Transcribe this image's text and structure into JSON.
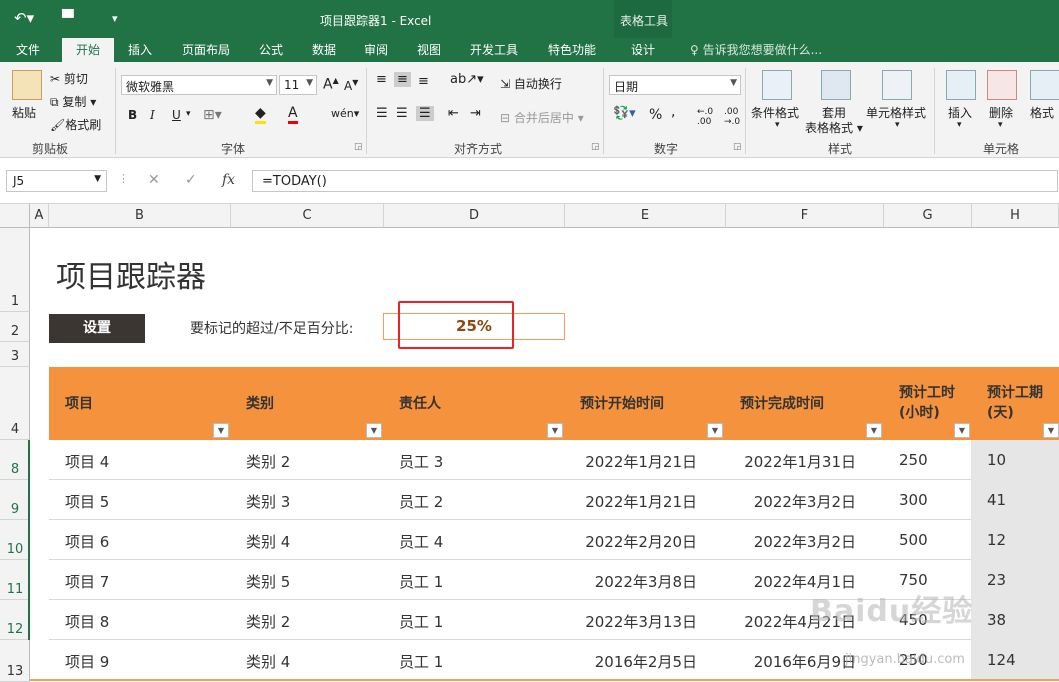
{
  "window": {
    "title": "项目跟踪器1 - Excel",
    "context_group": "表格工具"
  },
  "ribbon_tabs": [
    "文件",
    "开始",
    "插入",
    "页面布局",
    "公式",
    "数据",
    "审阅",
    "视图",
    "开发工具",
    "特色功能",
    "设计"
  ],
  "tell_me": "告诉我您想要做什么...",
  "clipboard": {
    "paste": "粘贴",
    "cut": "剪切",
    "copy": "复制",
    "format_painter": "格式刷",
    "label": "剪贴板"
  },
  "font": {
    "name": "微软雅黑",
    "size": "11",
    "label": "字体",
    "bold": "B",
    "italic": "I",
    "underline": "U"
  },
  "alignment": {
    "wrap": "自动换行",
    "merge": "合并后居中",
    "label": "对齐方式"
  },
  "number": {
    "format": "日期",
    "label": "数字"
  },
  "styles": {
    "conditional": "条件格式",
    "table_fmt_1": "套用",
    "table_fmt_2": "表格格式",
    "cell_styles": "单元格样式",
    "label": "样式"
  },
  "cells": {
    "insert": "插入",
    "delete": "删除",
    "format": "格式",
    "label": "单元格"
  },
  "formula_bar": {
    "name_box": "J5",
    "formula": "=TODAY()",
    "fx": "fx"
  },
  "columns": [
    "A",
    "B",
    "C",
    "D",
    "E",
    "F",
    "G",
    "H"
  ],
  "row_numbers": [
    "1",
    "2",
    "3",
    "4",
    "8",
    "9",
    "10",
    "11",
    "12",
    "13"
  ],
  "sheet": {
    "title": "项目跟踪器",
    "settings_button": "设置",
    "threshold_label": "要标记的超过/不足百分比:",
    "threshold_value": "25%"
  },
  "table": {
    "headers": [
      "项目",
      "类别",
      "责任人",
      "预计开始时间",
      "预计完成时间",
      "预计工时\n(小时)",
      "预计工期\n(天)"
    ],
    "rows": [
      [
        "项目 4",
        "类别 2",
        "员工 3",
        "2022年1月21日",
        "2022年1月31日",
        "250",
        "10"
      ],
      [
        "项目 5",
        "类别 3",
        "员工 2",
        "2022年1月21日",
        "2022年3月2日",
        "300",
        "41"
      ],
      [
        "项目 6",
        "类别 4",
        "员工 4",
        "2022年2月20日",
        "2022年3月2日",
        "500",
        "12"
      ],
      [
        "项目 7",
        "类别 5",
        "员工 1",
        "2022年3月8日",
        "2022年4月1日",
        "750",
        "23"
      ],
      [
        "项目 8",
        "类别 2",
        "员工 1",
        "2022年3月13日",
        "2022年4月21日",
        "450",
        "38"
      ],
      [
        "项目 9",
        "类别 4",
        "员工 1",
        "2016年2月5日",
        "2016年6月9日",
        "250",
        "124"
      ]
    ]
  },
  "watermark": {
    "text": "Baidu经验",
    "url_text": "jingyan.baidu.com"
  },
  "colors": {
    "excel_green": "#217346",
    "header_orange": "#f5923e",
    "highlight_red": "#e22222"
  }
}
